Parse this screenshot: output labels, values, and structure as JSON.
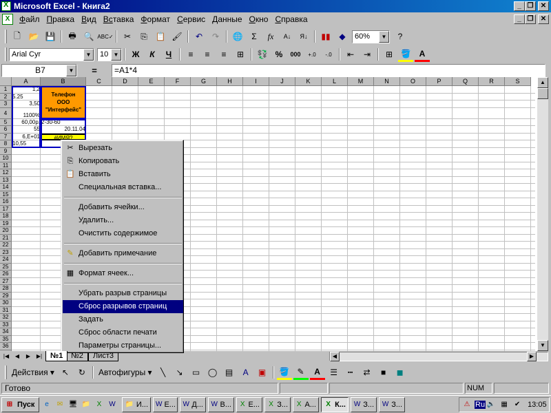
{
  "window": {
    "title": "Microsoft Excel - Книга2"
  },
  "menubar": {
    "items": [
      {
        "u": "Ф",
        "rest": "айл"
      },
      {
        "u": "П",
        "rest": "равка"
      },
      {
        "u": "В",
        "rest": "ид"
      },
      {
        "u": "Вс",
        "rest": "тавка"
      },
      {
        "u": "Ф",
        "rest": "ормат"
      },
      {
        "u": "С",
        "rest": "ервис"
      },
      {
        "u": "Д",
        "rest": "анные"
      },
      {
        "u": "О",
        "rest": "кно"
      },
      {
        "u": "С",
        "rest": "правка"
      }
    ]
  },
  "standard_toolbar": {
    "zoom": "60%"
  },
  "format_toolbar": {
    "font": "Arial Cyr",
    "size": "10",
    "bold": "Ж",
    "italic": "К",
    "underline": "Ч",
    "percent": "%",
    "thousands": "000"
  },
  "formula_bar": {
    "namebox": "B7",
    "equals": "=",
    "formula": "=A1*4"
  },
  "grid": {
    "columns": [
      "A",
      "B",
      "C",
      "D",
      "E",
      "F",
      "G",
      "H",
      "I",
      "J",
      "K",
      "L",
      "M",
      "N",
      "O",
      "P",
      "Q",
      "R",
      "S"
    ],
    "rows": [
      "1",
      "2",
      "3",
      "4",
      "5",
      "6",
      "7",
      "8",
      "9",
      "10",
      "11",
      "12",
      "13",
      "14",
      "15",
      "16",
      "17",
      "18",
      "19",
      "20",
      "21",
      "22",
      "23",
      "24",
      "25",
      "26",
      "27",
      "28",
      "29",
      "30",
      "31",
      "32",
      "33",
      "34",
      "35",
      "36",
      "37"
    ],
    "cells": {
      "a1": "1,2",
      "a2": "5.25",
      "a3": "3,50",
      "a4": "1100%",
      "a5": "60,00р.",
      "a6": "55",
      "a7": "6,E+01",
      "a8": "10,55",
      "b_merged": "Телефон ООО \"Интерфейс\"",
      "b5": "2-30-60",
      "b6": "20.11.04",
      "b7": "#ИМЯ?"
    }
  },
  "sheet_tabs": [
    "№1",
    "№2",
    "Лист3"
  ],
  "drawing_toolbar": {
    "actions": "Действия",
    "autoshapes": "Автофигуры"
  },
  "status": {
    "ready": "Готово",
    "num": "NUM"
  },
  "context_menu": {
    "items": [
      "Вырезать",
      "Копировать",
      "Вставить",
      "Специальная вставка...",
      "Добавить ячейки...",
      "Удалить...",
      "Очистить содержимое",
      "Добавить примечание",
      "Формат ячеек...",
      "Убрать разрыв страницы",
      "Сброс разрывов страниц",
      "Задать",
      "Сброс области печати",
      "Параметры страницы..."
    ],
    "highlighted": "Сброс разрывов страниц"
  },
  "taskbar": {
    "start": "Пуск",
    "tasks": [
      "И...",
      "Е...",
      "Д...",
      "В...",
      "Е...",
      "З...",
      "А...",
      "К...",
      "З...",
      "З..."
    ],
    "lang": "Ru",
    "clock": "13:05"
  }
}
